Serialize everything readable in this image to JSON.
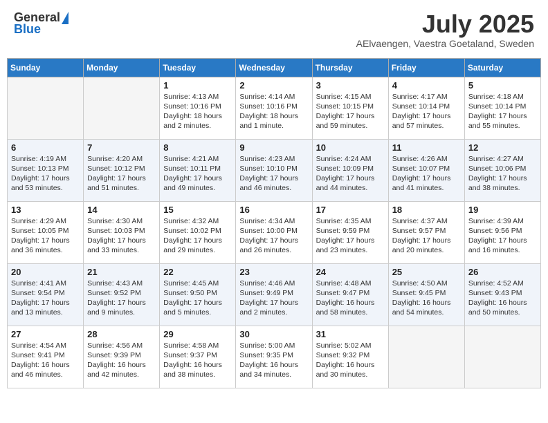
{
  "header": {
    "logo_general": "General",
    "logo_blue": "Blue",
    "title": "July 2025",
    "location": "AElvaengen, Vaestra Goetaland, Sweden"
  },
  "weekdays": [
    "Sunday",
    "Monday",
    "Tuesday",
    "Wednesday",
    "Thursday",
    "Friday",
    "Saturday"
  ],
  "weeks": [
    [
      {
        "day": "",
        "info": ""
      },
      {
        "day": "",
        "info": ""
      },
      {
        "day": "1",
        "info": "Sunrise: 4:13 AM\nSunset: 10:16 PM\nDaylight: 18 hours\nand 2 minutes."
      },
      {
        "day": "2",
        "info": "Sunrise: 4:14 AM\nSunset: 10:16 PM\nDaylight: 18 hours\nand 1 minute."
      },
      {
        "day": "3",
        "info": "Sunrise: 4:15 AM\nSunset: 10:15 PM\nDaylight: 17 hours\nand 59 minutes."
      },
      {
        "day": "4",
        "info": "Sunrise: 4:17 AM\nSunset: 10:14 PM\nDaylight: 17 hours\nand 57 minutes."
      },
      {
        "day": "5",
        "info": "Sunrise: 4:18 AM\nSunset: 10:14 PM\nDaylight: 17 hours\nand 55 minutes."
      }
    ],
    [
      {
        "day": "6",
        "info": "Sunrise: 4:19 AM\nSunset: 10:13 PM\nDaylight: 17 hours\nand 53 minutes."
      },
      {
        "day": "7",
        "info": "Sunrise: 4:20 AM\nSunset: 10:12 PM\nDaylight: 17 hours\nand 51 minutes."
      },
      {
        "day": "8",
        "info": "Sunrise: 4:21 AM\nSunset: 10:11 PM\nDaylight: 17 hours\nand 49 minutes."
      },
      {
        "day": "9",
        "info": "Sunrise: 4:23 AM\nSunset: 10:10 PM\nDaylight: 17 hours\nand 46 minutes."
      },
      {
        "day": "10",
        "info": "Sunrise: 4:24 AM\nSunset: 10:09 PM\nDaylight: 17 hours\nand 44 minutes."
      },
      {
        "day": "11",
        "info": "Sunrise: 4:26 AM\nSunset: 10:07 PM\nDaylight: 17 hours\nand 41 minutes."
      },
      {
        "day": "12",
        "info": "Sunrise: 4:27 AM\nSunset: 10:06 PM\nDaylight: 17 hours\nand 38 minutes."
      }
    ],
    [
      {
        "day": "13",
        "info": "Sunrise: 4:29 AM\nSunset: 10:05 PM\nDaylight: 17 hours\nand 36 minutes."
      },
      {
        "day": "14",
        "info": "Sunrise: 4:30 AM\nSunset: 10:03 PM\nDaylight: 17 hours\nand 33 minutes."
      },
      {
        "day": "15",
        "info": "Sunrise: 4:32 AM\nSunset: 10:02 PM\nDaylight: 17 hours\nand 29 minutes."
      },
      {
        "day": "16",
        "info": "Sunrise: 4:34 AM\nSunset: 10:00 PM\nDaylight: 17 hours\nand 26 minutes."
      },
      {
        "day": "17",
        "info": "Sunrise: 4:35 AM\nSunset: 9:59 PM\nDaylight: 17 hours\nand 23 minutes."
      },
      {
        "day": "18",
        "info": "Sunrise: 4:37 AM\nSunset: 9:57 PM\nDaylight: 17 hours\nand 20 minutes."
      },
      {
        "day": "19",
        "info": "Sunrise: 4:39 AM\nSunset: 9:56 PM\nDaylight: 17 hours\nand 16 minutes."
      }
    ],
    [
      {
        "day": "20",
        "info": "Sunrise: 4:41 AM\nSunset: 9:54 PM\nDaylight: 17 hours\nand 13 minutes."
      },
      {
        "day": "21",
        "info": "Sunrise: 4:43 AM\nSunset: 9:52 PM\nDaylight: 17 hours\nand 9 minutes."
      },
      {
        "day": "22",
        "info": "Sunrise: 4:45 AM\nSunset: 9:50 PM\nDaylight: 17 hours\nand 5 minutes."
      },
      {
        "day": "23",
        "info": "Sunrise: 4:46 AM\nSunset: 9:49 PM\nDaylight: 17 hours\nand 2 minutes."
      },
      {
        "day": "24",
        "info": "Sunrise: 4:48 AM\nSunset: 9:47 PM\nDaylight: 16 hours\nand 58 minutes."
      },
      {
        "day": "25",
        "info": "Sunrise: 4:50 AM\nSunset: 9:45 PM\nDaylight: 16 hours\nand 54 minutes."
      },
      {
        "day": "26",
        "info": "Sunrise: 4:52 AM\nSunset: 9:43 PM\nDaylight: 16 hours\nand 50 minutes."
      }
    ],
    [
      {
        "day": "27",
        "info": "Sunrise: 4:54 AM\nSunset: 9:41 PM\nDaylight: 16 hours\nand 46 minutes."
      },
      {
        "day": "28",
        "info": "Sunrise: 4:56 AM\nSunset: 9:39 PM\nDaylight: 16 hours\nand 42 minutes."
      },
      {
        "day": "29",
        "info": "Sunrise: 4:58 AM\nSunset: 9:37 PM\nDaylight: 16 hours\nand 38 minutes."
      },
      {
        "day": "30",
        "info": "Sunrise: 5:00 AM\nSunset: 9:35 PM\nDaylight: 16 hours\nand 34 minutes."
      },
      {
        "day": "31",
        "info": "Sunrise: 5:02 AM\nSunset: 9:32 PM\nDaylight: 16 hours\nand 30 minutes."
      },
      {
        "day": "",
        "info": ""
      },
      {
        "day": "",
        "info": ""
      }
    ]
  ]
}
